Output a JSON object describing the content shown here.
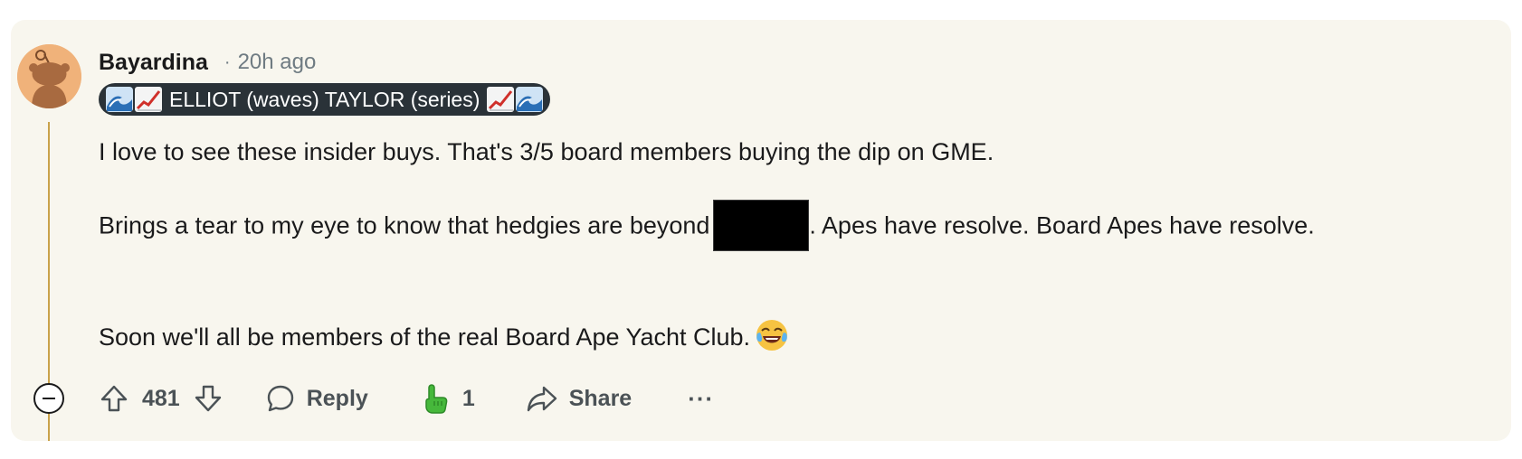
{
  "comment": {
    "author": "Bayardina",
    "separator": "·",
    "timestamp": "20h ago",
    "flair_text": "ELLIOT (waves) TAYLOR (series)",
    "body": {
      "p1": "I love to see these insider buys. That's 3/5 board members buying the dip on GME.",
      "p2_before": "Brings a tear to my eye to know that hedgies are beyond",
      "p2_after": ". Apes have resolve. Board Apes have resolve.",
      "p3": "Soon we'll all be members of the real Board Ape Yacht Club."
    },
    "actions": {
      "score": "481",
      "reply_label": "Reply",
      "award_count": "1",
      "share_label": "Share",
      "more_label": "···"
    }
  },
  "icons": {
    "avatar": "reddit-snoo-avatar-icon",
    "flair_left": [
      "wave-icon",
      "chart-increasing-icon"
    ],
    "flair_right": [
      "chart-increasing-icon",
      "wave-icon"
    ],
    "emoji_end": "tears-of-joy-icon",
    "upvote": "upvote-arrow-icon",
    "downvote": "downvote-arrow-icon",
    "reply": "speech-bubble-icon",
    "award": "pointing-hand-award-icon",
    "share": "share-arrow-icon",
    "collapse": "collapse-minus-icon"
  },
  "colors": {
    "card_background": "#f8f6ee",
    "thread_line": "#c9a24a",
    "avatar_background": "#f0b27a",
    "flair_background": "#2a3238",
    "meta_text": "#6f7b82",
    "action_text": "#4b5256"
  }
}
